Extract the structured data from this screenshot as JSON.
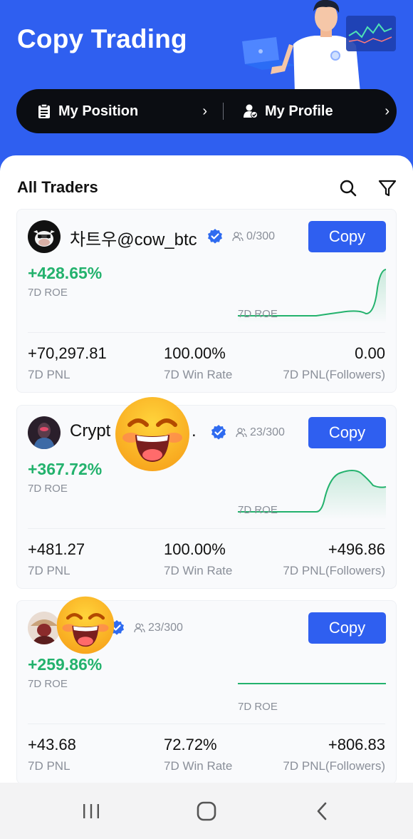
{
  "header": {
    "title": "Copy Trading",
    "my_position": "My Position",
    "my_profile": "My Profile",
    "chevron": "›"
  },
  "section": {
    "title": "All Traders"
  },
  "traders": [
    {
      "name": "차트우@cow_btc",
      "followers": "0/300",
      "copy": "Copy",
      "roe": "+428.65%",
      "roe_label": "7D ROE",
      "chart_label": "7D ROE",
      "pnl": "+70,297.81",
      "pnl_label": "7D PNL",
      "win_rate": "100.00%",
      "win_rate_label": "7D Win Rate",
      "followers_pnl": "0.00",
      "followers_pnl_label": "7D PNL(Followers)"
    },
    {
      "name": "Crypt",
      "name_tail": ".",
      "followers": "23/300",
      "copy": "Copy",
      "roe": "+367.72%",
      "roe_label": "7D ROE",
      "chart_label": "7D ROE",
      "pnl": "+481.27",
      "pnl_label": "7D PNL",
      "win_rate": "100.00%",
      "win_rate_label": "7D Win Rate",
      "followers_pnl": "+496.86",
      "followers_pnl_label": "7D PNL(Followers)"
    },
    {
      "name": "",
      "followers": "23/300",
      "copy": "Copy",
      "roe": "+259.86%",
      "roe_label": "7D ROE",
      "chart_label": "7D ROE",
      "pnl": "+43.68",
      "pnl_label": "7D PNL",
      "win_rate": "72.72%",
      "win_rate_label": "7D Win Rate",
      "followers_pnl": "+806.83",
      "followers_pnl_label": "7D PNL(Followers)"
    }
  ],
  "colors": {
    "brand_blue": "#2f5ff0",
    "positive_green": "#23b26d",
    "muted_text": "#8a8f99"
  },
  "icons": [
    "clipboard-icon",
    "user-check-icon",
    "search-icon",
    "filter-icon",
    "verified-badge-icon",
    "followers-icon",
    "recent-apps-icon",
    "home-icon",
    "back-icon"
  ]
}
